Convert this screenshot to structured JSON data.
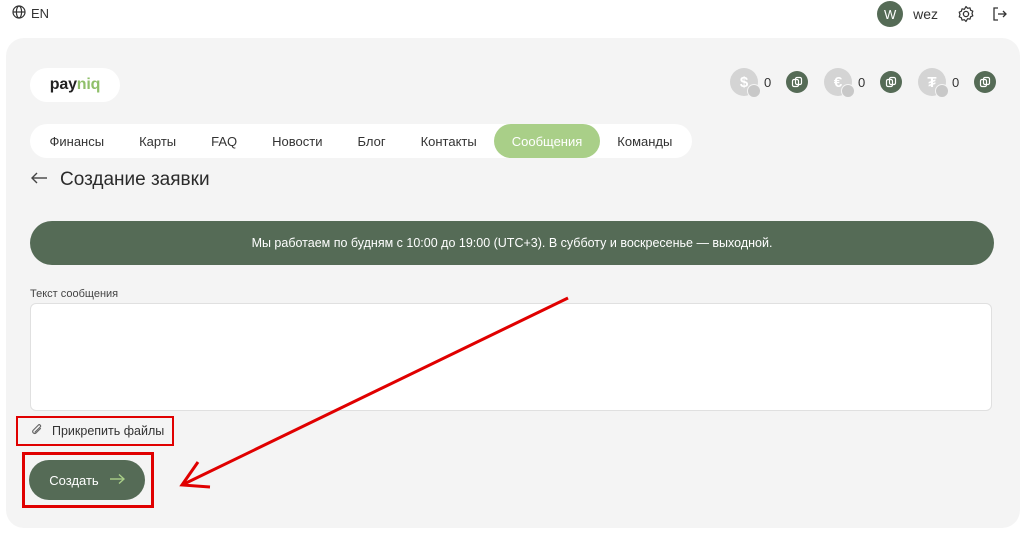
{
  "topbar": {
    "language": "EN",
    "user_initial": "W",
    "username": "wez"
  },
  "logo": {
    "part1": "pay",
    "part2": "niq"
  },
  "balances": [
    {
      "symbol": "$",
      "value": "0"
    },
    {
      "symbol": "€",
      "value": "0"
    },
    {
      "symbol": "₮",
      "value": "0"
    }
  ],
  "nav": {
    "items": [
      "Финансы",
      "Карты",
      "FAQ",
      "Новости",
      "Блог",
      "Контакты",
      "Сообщения",
      "Команды"
    ],
    "active": "Сообщения"
  },
  "page": {
    "title": "Создание заявки"
  },
  "banner": {
    "text": "Мы работаем по будням с 10:00 до 19:00 (UTC+3). В субботу и воскресенье — выходной."
  },
  "form": {
    "message_label": "Текст сообщения",
    "message_value": "",
    "attach_label": "Прикрепить файлы",
    "create_label": "Создать"
  },
  "colors": {
    "brand": "#556b56",
    "active_tab": "#a9cf88",
    "highlight": "#e00000"
  }
}
